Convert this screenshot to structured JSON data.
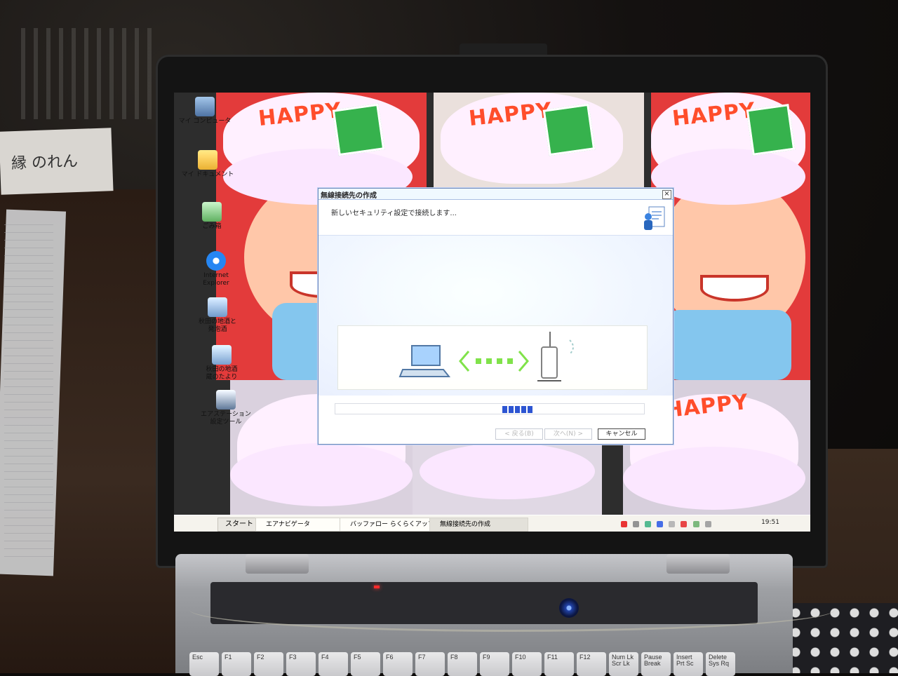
{
  "room": {
    "note_card_text": "縁 のれん"
  },
  "desktop": {
    "icons": [
      {
        "label": "マイ コンピュータ",
        "icon": "my-computer-icon"
      },
      {
        "label": "マイ ドキュメント",
        "icon": "my-documents-icon"
      },
      {
        "label": "ごみ箱",
        "icon": "recycle-bin-icon"
      },
      {
        "label": "Internet\nExplorer",
        "icon": "internet-explorer-icon"
      },
      {
        "label": "秋田の地酒と\n発泡酒",
        "icon": "shortcut-icon"
      },
      {
        "label": "秋田の地酒\n蔵のたより",
        "icon": "shortcut-icon"
      },
      {
        "label": "エアステーション\n設定ツール",
        "icon": "airstation-tool-icon"
      }
    ],
    "wallpaper_text": "HAPPY"
  },
  "dialog": {
    "title": "無線接続先の作成",
    "close_label": "×",
    "heading": "新しいセキュリティ設定で接続します...",
    "buttons": {
      "back": "< 戻る(B)",
      "next": "次へ(N) >",
      "cancel": "キャンセル"
    }
  },
  "taskbar": {
    "start_label": "スタート",
    "tasks": [
      {
        "label": "エアナビゲータ"
      },
      {
        "label": "バッファロー らくらくアップデ"
      },
      {
        "label": "無線接続先の作成"
      }
    ],
    "clock": "19:51"
  },
  "keyboard": {
    "keys": [
      "Esc",
      "F1",
      "F2",
      "F3",
      "F4",
      "F5",
      "F6",
      "F7",
      "F8",
      "F9",
      "F10",
      "F11",
      "F12",
      "Num Lk\nScr Lk",
      "Pause\nBreak",
      "Insert\nPrt Sc",
      "Delete\nSys Rq"
    ]
  },
  "colors": {
    "accent_progress": "#2d4fb8",
    "hat_text": "#e24a2e",
    "desk": "#3a2a20"
  }
}
